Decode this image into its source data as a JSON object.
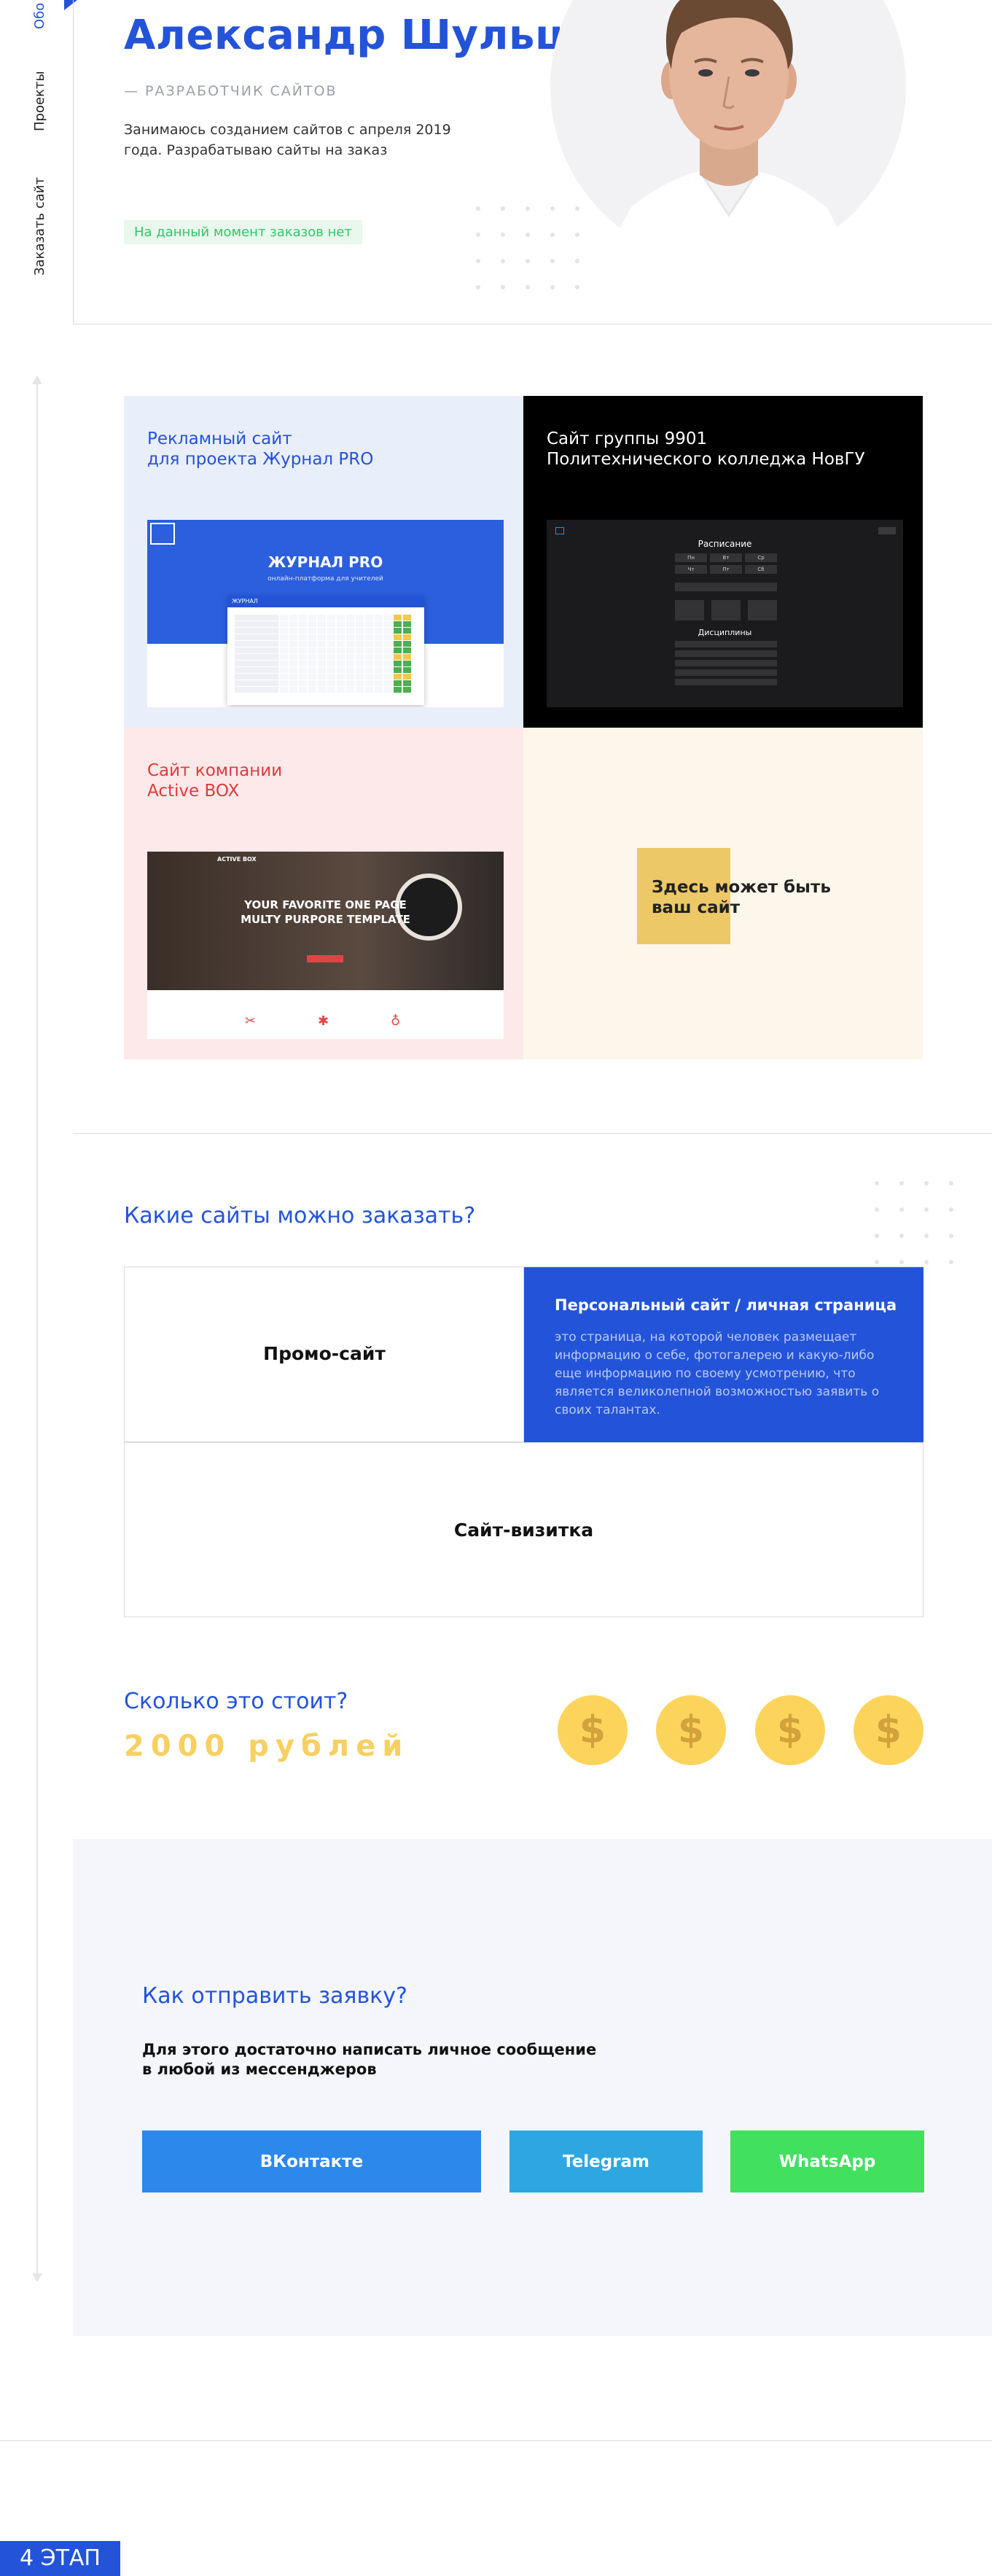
{
  "nav": {
    "about": "Обо",
    "projects": "Проекты",
    "order": "Заказать сайт"
  },
  "hero": {
    "name": "Александр Шульцев",
    "role": "— РАЗРАБОТЧИК САЙТОВ",
    "bio": "Занимаюсь созданием сайтов с апреля 2019 года. Разрабатываю сайты на заказ",
    "status": "На данный момент заказов нет"
  },
  "projects": [
    {
      "title_line1": "Рекламный сайт",
      "title_line2": "для проекта Журнал PRO",
      "shot": {
        "logo": "ЖУРНАЛ PRO",
        "subtitle": "онлайн-платформа для учителей",
        "nav_brand": "ЖУРНАЛ"
      }
    },
    {
      "title_line1": "Сайт группы 9901",
      "title_line2": "Политехнического колледжа НовГУ",
      "shot": {
        "heading_schedule": "Расписание",
        "days": [
          "Пн",
          "Вт",
          "Ср",
          "Чт",
          "Пт",
          "Сб"
        ],
        "heading_subjects": "Дисциплины"
      }
    },
    {
      "title_line1": "Сайт компании",
      "title_line2": "Active BOX",
      "shot": {
        "brand": "ACTIVE BOX",
        "headline_1": "YOUR FAVORITE ONE PAGE",
        "headline_2": "MULTY PURPORE TEMPLATE"
      }
    },
    {
      "placeholder_line1": "Здесь может быть",
      "placeholder_line2": "ваш сайт"
    }
  ],
  "types": {
    "title": "Какие сайты можно заказать?",
    "promo": "Промо-сайт",
    "personal_title": "Персональный сайт / личная страница",
    "personal_desc": "это страница, на которой человек размещает информацию о себе, фотогалерею и какую-либо еще информацию по своему усмотрению, что является великолепной возможностью заявить о своих талантах.",
    "card": "Сайт-визитка"
  },
  "pricing": {
    "title": "Сколько это стоит?",
    "price": "2000 рублей",
    "coin_symbol": "$"
  },
  "contact": {
    "title": "Как отправить заявку?",
    "text_line1": "Для этого достаточно написать личное сообщение",
    "text_line2": "в любой из мессенджеров",
    "buttons": [
      {
        "label": "ВКонтакте",
        "color": "#2d88ec"
      },
      {
        "label": "Telegram",
        "color": "#2ea7e0"
      },
      {
        "label": "WhatsApp",
        "color": "#41e05f"
      }
    ]
  },
  "footer": {
    "stage": "4 ЭТАП"
  },
  "colors": {
    "accent": "#2353d9",
    "gold": "#f8cf63",
    "status_green": "#35c56a"
  }
}
